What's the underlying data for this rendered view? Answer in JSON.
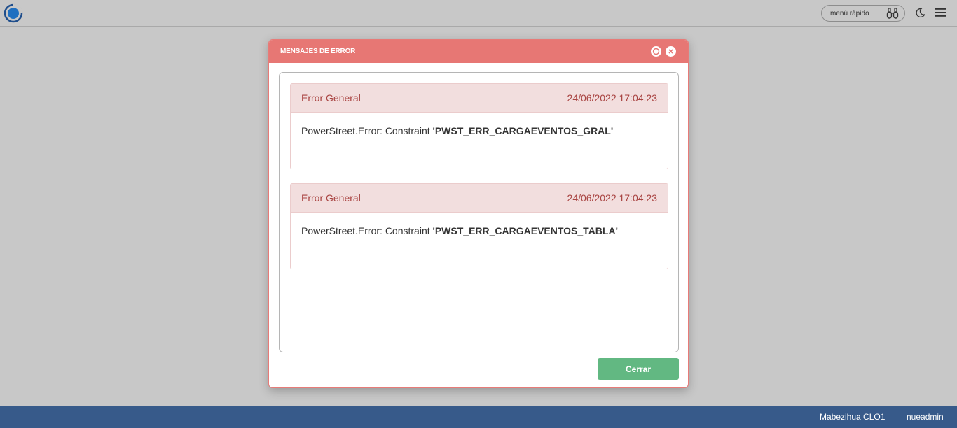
{
  "topbar": {
    "quick_menu_label": "menú rápido"
  },
  "modal": {
    "title": "MENSAJES DE ERROR",
    "messages": [
      {
        "title": "Error General",
        "timestamp": "24/06/2022 17:04:23",
        "text_prefix": "PowerStreet.Error: Constraint ",
        "constraint": "'PWST_ERR_CARGAEVENTOS_GRAL'"
      },
      {
        "title": "Error General",
        "timestamp": "24/06/2022 17:04:23",
        "text_prefix": "PowerStreet.Error: Constraint ",
        "constraint": "'PWST_ERR_CARGAEVENTOS_TABLA'"
      }
    ],
    "close_button_label": "Cerrar"
  },
  "footer": {
    "site": "Mabezihua CLO1",
    "user": "nueadmin"
  },
  "colors": {
    "header_red": "#e77774",
    "error_bg": "#f2dede",
    "error_text": "#a94442",
    "button_green": "#62b882",
    "footer_blue": "#375a8a"
  },
  "icons": {
    "logo": "app-logo-icon",
    "quick_menu": "binoculars-icon",
    "theme": "moon-icon",
    "menu": "hamburger-menu-icon",
    "restore": "restore-icon",
    "close": "close-icon"
  }
}
